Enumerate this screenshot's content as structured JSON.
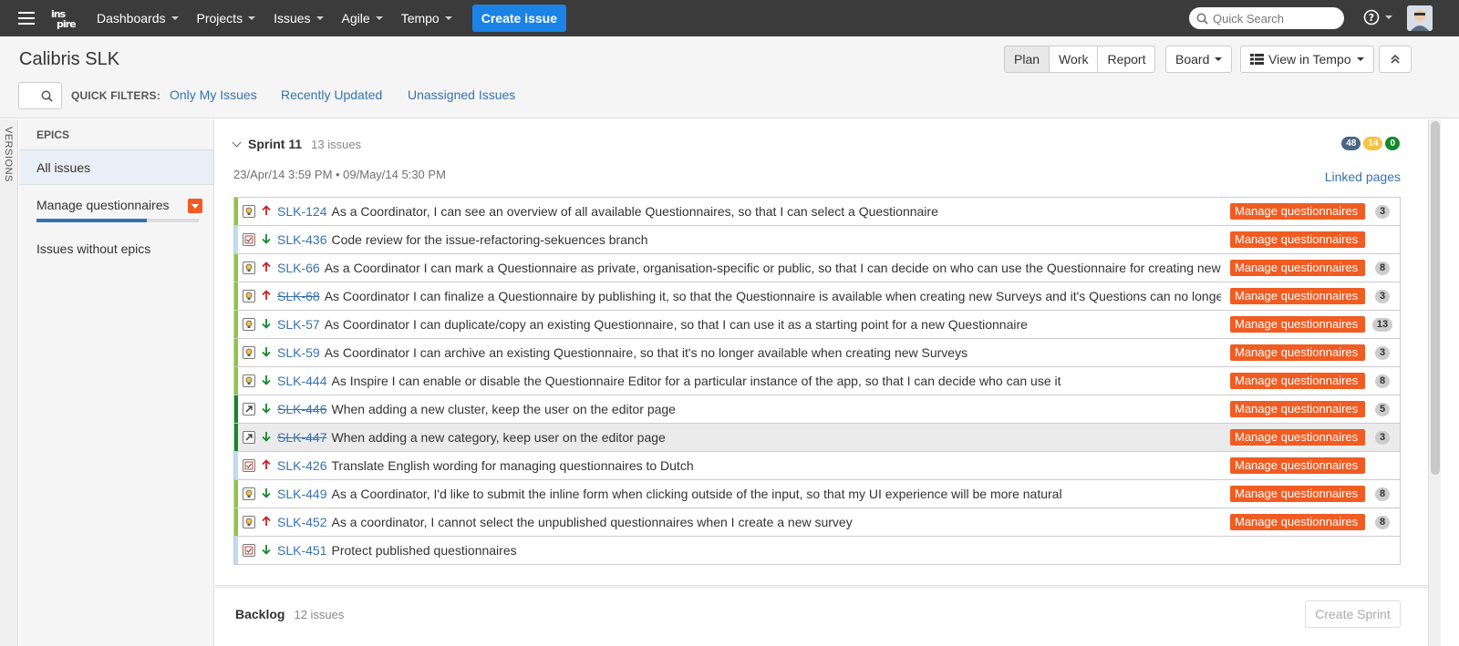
{
  "topnav": {
    "logo_line1": "ins",
    "logo_line2": "pire",
    "menu": [
      {
        "label": "Dashboards"
      },
      {
        "label": "Projects"
      },
      {
        "label": "Issues"
      },
      {
        "label": "Agile"
      },
      {
        "label": "Tempo"
      }
    ],
    "create_label": "Create issue",
    "search_placeholder": "Quick Search",
    "help_icon": "help-icon"
  },
  "header": {
    "title": "Calibris SLK",
    "modes": [
      "Plan",
      "Work",
      "Report"
    ],
    "active_mode": "Plan",
    "board_label": "Board",
    "tempo_label": "View in Tempo",
    "quick_filters_label": "QUICK FILTERS:",
    "quick_filters": [
      "Only My Issues",
      "Recently Updated",
      "Unassigned Issues"
    ]
  },
  "rail": {
    "versions_label": "VERSIONS"
  },
  "epics": {
    "title": "EPICS",
    "all_label": "All issues",
    "epic_name": "Manage questionnaires",
    "epic_progress": 0.68,
    "none_label": "Issues without epics"
  },
  "sprint": {
    "name": "Sprint 11",
    "count": "13 issues",
    "dates": "23/Apr/14 3:59 PM • 09/May/14 5:30 PM",
    "linked_pages": "Linked pages",
    "badges": [
      {
        "value": "48",
        "color": "#4a6785"
      },
      {
        "value": "14",
        "color": "#f6c342"
      },
      {
        "value": "0",
        "color": "#14892c"
      }
    ]
  },
  "colors": {
    "story": "#8cc63f",
    "task": "#bfdcf5",
    "subtask": "#14892c",
    "epic": "#f15c22",
    "link": "#3572b0",
    "priority_up": "#cc2222",
    "priority_down": "#14892c"
  },
  "issues": [
    {
      "key": "SLK-124",
      "summary": "As a Coordinator, I can see an overview of all available Questionnaires, so that I can select a Questionnaire",
      "type": "story",
      "priority": "up",
      "done": false,
      "epic": "Manage questionnaires",
      "estimate": "3"
    },
    {
      "key": "SLK-436",
      "summary": "Code review for the issue-refactoring-sekuences branch",
      "type": "task",
      "priority": "down",
      "done": false,
      "epic": "Manage questionnaires",
      "estimate": ""
    },
    {
      "key": "SLK-66",
      "summary": "As a Coordinator I can mark a Questionnaire as private, organisation-specific or public, so that I can decide on who can use the Questionnaire for creating new Surveys",
      "type": "story",
      "priority": "up",
      "done": false,
      "epic": "Manage questionnaires",
      "estimate": "8"
    },
    {
      "key": "SLK-68",
      "summary": "As Coordinator I can finalize a Questionnaire by publishing it, so that the Questionnaire is available when creating new Surveys and it's Questions can no longer be changed",
      "type": "story",
      "priority": "up",
      "done": true,
      "epic": "Manage questionnaires",
      "estimate": "3"
    },
    {
      "key": "SLK-57",
      "summary": "As Coordinator I can duplicate/copy an existing Questionnaire, so that I can use it as a starting point for a new Questionnaire",
      "type": "story",
      "priority": "down",
      "done": false,
      "epic": "Manage questionnaires",
      "estimate": "13"
    },
    {
      "key": "SLK-59",
      "summary": "As Coordinator I can archive an existing Questionnaire, so that it's no longer available when creating new Surveys",
      "type": "story",
      "priority": "down",
      "done": false,
      "epic": "Manage questionnaires",
      "estimate": "3"
    },
    {
      "key": "SLK-444",
      "summary": "As Inspire I can enable or disable the Questionnaire Editor for a particular instance of the app, so that I can decide who can use it",
      "type": "story",
      "priority": "down",
      "done": false,
      "epic": "Manage questionnaires",
      "estimate": "8"
    },
    {
      "key": "SLK-446",
      "summary": "When adding a new cluster, keep the user on the editor page",
      "type": "subtask",
      "priority": "down",
      "done": true,
      "epic": "Manage questionnaires",
      "estimate": "5"
    },
    {
      "key": "SLK-447",
      "summary": "When adding a new category, keep user on the editor page",
      "type": "subtask",
      "priority": "down",
      "done": true,
      "epic": "Manage questionnaires",
      "estimate": "3",
      "selected": true
    },
    {
      "key": "SLK-426",
      "summary": "Translate English wording for managing questionnaires to Dutch",
      "type": "task",
      "priority": "up",
      "done": false,
      "epic": "Manage questionnaires",
      "estimate": ""
    },
    {
      "key": "SLK-449",
      "summary": "As a Coordinator, I'd like to submit the inline form when clicking outside of the input, so that my UI experience will be more natural",
      "type": "story",
      "priority": "down",
      "done": false,
      "epic": "Manage questionnaires",
      "estimate": "8"
    },
    {
      "key": "SLK-452",
      "summary": "As a coordinator, I cannot select the unpublished questionnaires when I create a new survey",
      "type": "story",
      "priority": "up",
      "done": false,
      "epic": "Manage questionnaires",
      "estimate": "8"
    },
    {
      "key": "SLK-451",
      "summary": "Protect published questionnaires",
      "type": "task",
      "priority": "down",
      "done": false,
      "epic": "",
      "estimate": ""
    }
  ],
  "backlog": {
    "name": "Backlog",
    "count": "12 issues",
    "create_sprint_label": "Create Sprint"
  }
}
